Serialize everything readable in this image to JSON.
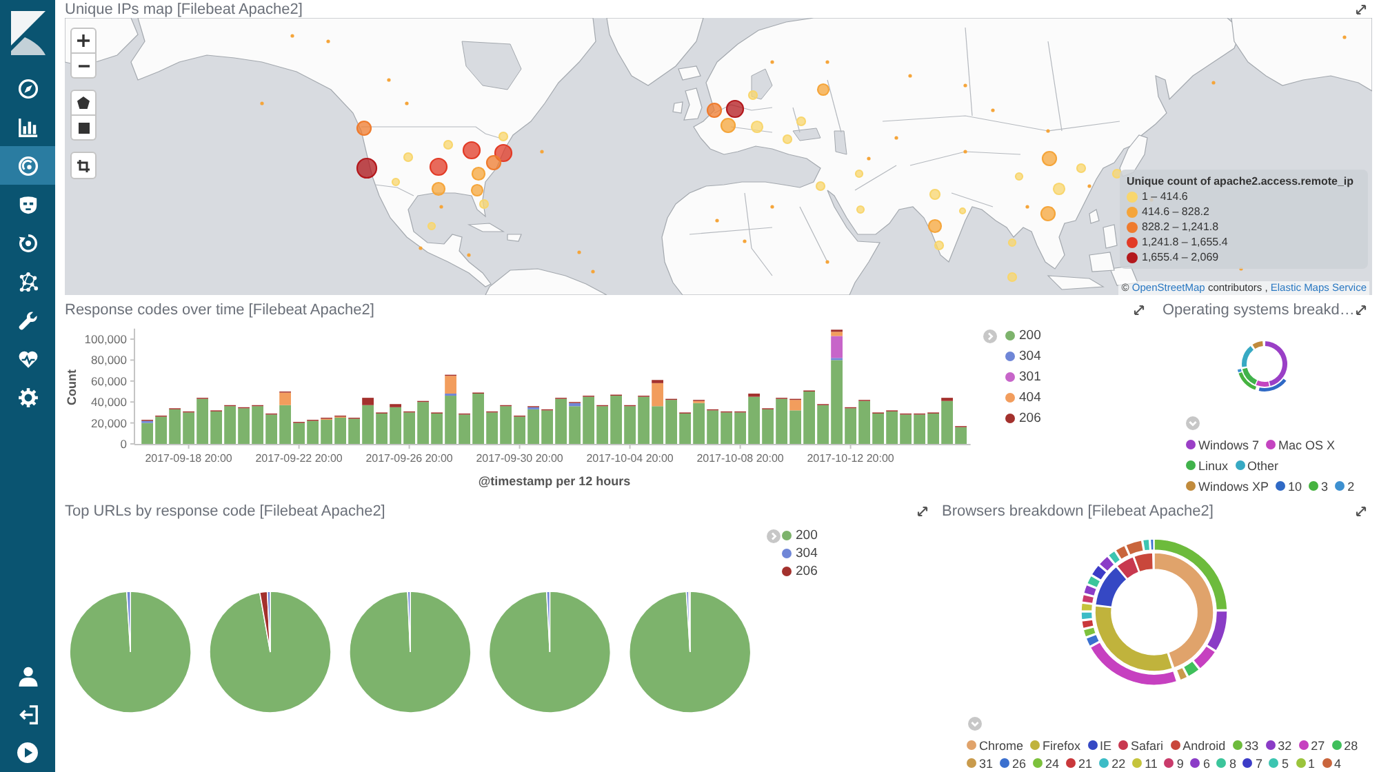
{
  "sidebar": {
    "items": [
      {
        "selected": false
      },
      {
        "selected": false
      },
      {
        "selected": true
      },
      {
        "selected": false
      },
      {
        "selected": false
      },
      {
        "selected": false
      },
      {
        "selected": false
      },
      {
        "selected": false
      },
      {
        "selected": false
      }
    ]
  },
  "map_panel": {
    "title": "Unique IPs map [Filebeat Apache2]",
    "legend": {
      "title": "Unique count of apache2.access.remote_ip",
      "items": [
        {
          "label": "1 – 414.6",
          "color": "#f8d66d"
        },
        {
          "label": "414.6 – 828.2",
          "color": "#f5a53a"
        },
        {
          "label": "828.2 – 1,241.8",
          "color": "#ef7b2d"
        },
        {
          "label": "1,241.8 – 1,655.4",
          "color": "#e23a25"
        },
        {
          "label": "1,655.4 – 2,069",
          "color": "#b3181c"
        }
      ]
    },
    "attribution": [
      {
        "kind": "text",
        "text": "©"
      },
      {
        "kind": "link",
        "text": "OpenStreetMap"
      },
      {
        "kind": "text",
        "text": "contributors ,"
      },
      {
        "kind": "link",
        "text": "Elastic Maps Service"
      }
    ]
  },
  "response_codes_panel": {
    "title": "Response codes over time [Filebeat Apache2]",
    "chart_data": {
      "type": "bar",
      "stacked": true,
      "xlabel": "@timestamp per 12 hours",
      "ylabel": "Count",
      "categories": [
        null,
        null,
        null,
        "2017-09-18 20:00",
        null,
        null,
        null,
        null,
        null,
        null,
        null,
        "2017-09-22 20:00",
        null,
        null,
        null,
        null,
        null,
        null,
        null,
        "2017-09-26 20:00",
        null,
        null,
        null,
        null,
        null,
        null,
        null,
        "2017-09-30 20:00",
        null,
        null,
        null,
        null,
        null,
        null,
        null,
        "2017-10-04 20:00",
        null,
        null,
        null,
        null,
        null,
        null,
        null,
        "2017-10-08 20:00",
        null,
        null,
        null,
        null,
        null,
        null,
        null,
        "2017-10-12 20:00",
        null,
        null,
        null,
        null,
        null,
        null,
        null,
        null
      ],
      "series": [
        {
          "name": "200",
          "color": "#7db36c",
          "values": [
            20000,
            26000,
            33000,
            30000,
            43000,
            31000,
            36000,
            34000,
            36000,
            28000,
            37000,
            20000,
            22000,
            23000,
            25000,
            24000,
            37000,
            29000,
            35000,
            30000,
            40000,
            29000,
            46000,
            28000,
            48000,
            30000,
            36000,
            26000,
            33000,
            32000,
            43000,
            36000,
            45000,
            36000,
            46000,
            36000,
            45000,
            36000,
            42000,
            29000,
            39000,
            32000,
            30000,
            30000,
            45000,
            33000,
            43000,
            32000,
            50000,
            37000,
            80000,
            34000,
            41000,
            29000,
            31000,
            28000,
            28000,
            29000,
            41000,
            16000
          ]
        },
        {
          "name": "304",
          "color": "#6f86d7",
          "values": [
            2000,
            0,
            0,
            0,
            0,
            0,
            0,
            0,
            0,
            0,
            0,
            0,
            0,
            0,
            0,
            0,
            0,
            0,
            0,
            0,
            0,
            0,
            2000,
            0,
            0,
            0,
            0,
            0,
            2000,
            0,
            0,
            3000,
            0,
            0,
            0,
            0,
            0,
            0,
            0,
            0,
            0,
            0,
            0,
            0,
            0,
            0,
            0,
            0,
            0,
            0,
            2000,
            0,
            0,
            0,
            0,
            0,
            0,
            0,
            0,
            0
          ]
        },
        {
          "name": "301",
          "color": "#c765c9",
          "values": [
            0,
            0,
            0,
            0,
            0,
            0,
            0,
            0,
            0,
            0,
            0,
            0,
            0,
            0,
            0,
            0,
            0,
            0,
            0,
            0,
            0,
            0,
            0,
            0,
            0,
            0,
            0,
            0,
            0,
            0,
            0,
            0,
            0,
            0,
            0,
            0,
            0,
            0,
            0,
            0,
            0,
            0,
            0,
            0,
            0,
            0,
            0,
            0,
            0,
            0,
            21000,
            0,
            0,
            0,
            0,
            0,
            0,
            0,
            0,
            0
          ]
        },
        {
          "name": "404",
          "color": "#f29d5d",
          "values": [
            0,
            0,
            0,
            0,
            0,
            0,
            0,
            0,
            0,
            0,
            12000,
            0,
            0,
            1000,
            1000,
            0,
            0,
            0,
            0,
            0,
            0,
            0,
            17000,
            0,
            0,
            0,
            0,
            0,
            0,
            0,
            0,
            0,
            0,
            0,
            0,
            0,
            0,
            22000,
            0,
            0,
            2000,
            0,
            0,
            0,
            0,
            0,
            0,
            10000,
            0,
            0,
            4000,
            0,
            0,
            0,
            0,
            0,
            0,
            0,
            0,
            0
          ]
        },
        {
          "name": "206",
          "color": "#a3312d",
          "values": [
            1000,
            1000,
            1000,
            1000,
            1000,
            1000,
            1000,
            1000,
            1000,
            1000,
            1000,
            1000,
            1000,
            1000,
            1000,
            1000,
            7000,
            1000,
            3000,
            1000,
            1000,
            1000,
            1000,
            1000,
            1000,
            1000,
            1000,
            1000,
            1000,
            1000,
            1000,
            1000,
            1000,
            1000,
            1000,
            1000,
            1000,
            3000,
            1000,
            1000,
            1000,
            1000,
            1000,
            1000,
            3000,
            1000,
            1000,
            1000,
            1000,
            1000,
            2000,
            1000,
            1000,
            1000,
            1000,
            1000,
            1000,
            1000,
            3000,
            1000
          ]
        }
      ],
      "ylim": [
        0,
        110000
      ],
      "yticks": [
        {
          "value": 0,
          "label": "0"
        },
        {
          "value": 20000,
          "label": "20,000"
        },
        {
          "value": 40000,
          "label": "40,000"
        },
        {
          "value": 60000,
          "label": "60,000"
        },
        {
          "value": 80000,
          "label": "80,000"
        },
        {
          "value": 100000,
          "label": "100,000"
        }
      ]
    }
  },
  "os_panel": {
    "title": "Operating systems breakd…",
    "legend": [
      {
        "label": "Windows 7",
        "color": "#9a3fc6"
      },
      {
        "label": "Mac OS X",
        "color": "#c444c0"
      },
      {
        "label": "Linux",
        "color": "#40b24b"
      },
      {
        "label": "Other",
        "color": "#37a9c3"
      },
      {
        "label": "Windows XP",
        "color": "#c18b3c"
      },
      {
        "label": "10",
        "color": "#2f69c5"
      },
      {
        "label": "3",
        "color": "#46b340"
      },
      {
        "label": "2",
        "color": "#3d90d0"
      }
    ]
  },
  "top_urls_panel": {
    "title": "Top URLs by response code [Filebeat Apache2]",
    "legend": [
      {
        "label": "200",
        "color": "#7db36c"
      },
      {
        "label": "304",
        "color": "#6f86d7"
      },
      {
        "label": "206",
        "color": "#a3312d"
      }
    ]
  },
  "browsers_panel": {
    "title": "Browsers breakdown [Filebeat Apache2]",
    "legend": [
      {
        "label": "Chrome",
        "color": "#e0a36b"
      },
      {
        "label": "Firefox",
        "color": "#c0b33c"
      },
      {
        "label": "IE",
        "color": "#3548c4"
      },
      {
        "label": "Safari",
        "color": "#c8384f"
      },
      {
        "label": "Android",
        "color": "#c9473b"
      },
      {
        "label": "33",
        "color": "#6dbb3c"
      },
      {
        "label": "32",
        "color": "#8a3cc6"
      },
      {
        "label": "27",
        "color": "#c640c0"
      },
      {
        "label": "28",
        "color": "#3fbf5b"
      },
      {
        "label": "31",
        "color": "#c99b4c"
      },
      {
        "label": "26",
        "color": "#3b70cf"
      },
      {
        "label": "24",
        "color": "#7cc13c"
      },
      {
        "label": "21",
        "color": "#c9383b"
      },
      {
        "label": "22",
        "color": "#3cbcc6"
      },
      {
        "label": "11",
        "color": "#c5c43c"
      },
      {
        "label": "9",
        "color": "#c93b6b"
      },
      {
        "label": "6",
        "color": "#8b3cc7"
      },
      {
        "label": "8",
        "color": "#3cc59b"
      },
      {
        "label": "7",
        "color": "#3c3cc7"
      },
      {
        "label": "5",
        "color": "#3cc5b1"
      },
      {
        "label": "1",
        "color": "#9bc43c"
      },
      {
        "label": "4",
        "color": "#c9653c"
      }
    ]
  }
}
